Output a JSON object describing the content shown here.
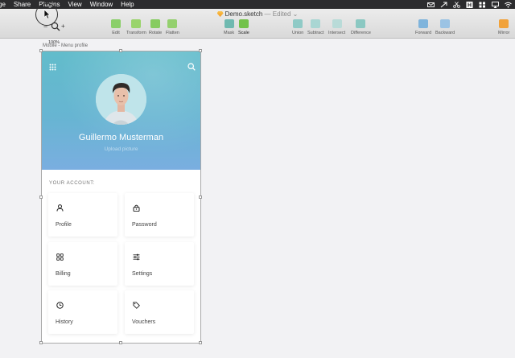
{
  "menubar": {
    "items": [
      "ge",
      "Share",
      "Plugins",
      "View",
      "Window",
      "Help"
    ],
    "tray_icons": [
      "envelope-icon",
      "arrow-icon",
      "scissors-icon",
      "h-box-icon",
      "grid-icon",
      "airplay-icon",
      "wifi-icon"
    ]
  },
  "toolbar": {
    "document_name": "Demo.sketch",
    "document_status": "— Edited",
    "zoom_level": "100%",
    "zoom_minus": "−",
    "zoom_plus": "+",
    "tools": [
      {
        "label": "Edit",
        "icon": "edit-icon",
        "color": "#8bcf6a"
      },
      {
        "label": "Transform",
        "icon": "transform-icon",
        "color": "#9ad46b"
      },
      {
        "label": "Rotate",
        "icon": "rotate-icon",
        "color": "#86cc60"
      },
      {
        "label": "Flatten",
        "icon": "flatten-icon",
        "color": "#94d06e"
      },
      {
        "label": "Mask",
        "icon": "mask-icon",
        "color": "#6fb9b0"
      },
      {
        "label": "Scale",
        "icon": "scale-icon",
        "color": "#73c24a"
      },
      {
        "label": "Union",
        "icon": "union-icon",
        "color": "#8fcac6"
      },
      {
        "label": "Subtract",
        "icon": "subtract-icon",
        "color": "#a9d6d3"
      },
      {
        "label": "Intersect",
        "icon": "intersect-icon",
        "color": "#b9dbd8"
      },
      {
        "label": "Difference",
        "icon": "difference-icon",
        "color": "#8bc8c2"
      },
      {
        "label": "Forward",
        "icon": "forward-icon",
        "color": "#7fb4dc"
      },
      {
        "label": "Backward",
        "icon": "backward-icon",
        "color": "#9bc3e4"
      },
      {
        "label": "Mirror",
        "icon": "mirror-icon",
        "color": "#f1a23a"
      }
    ]
  },
  "canvas": {
    "artboard_label": "Mobile - Menu profile"
  },
  "profile": {
    "name": "Guillermo Musterman",
    "upload_label": "Upload picture"
  },
  "account": {
    "heading": "YOUR ACCOUNT:",
    "cards": [
      {
        "label": "Profile",
        "icon": "user-icon"
      },
      {
        "label": "Password",
        "icon": "lock-icon"
      },
      {
        "label": "Billing",
        "icon": "apps-icon"
      },
      {
        "label": "Settings",
        "icon": "sliders-icon"
      },
      {
        "label": "History",
        "icon": "clock-icon"
      },
      {
        "label": "Vouchers",
        "icon": "tag-icon"
      }
    ]
  }
}
